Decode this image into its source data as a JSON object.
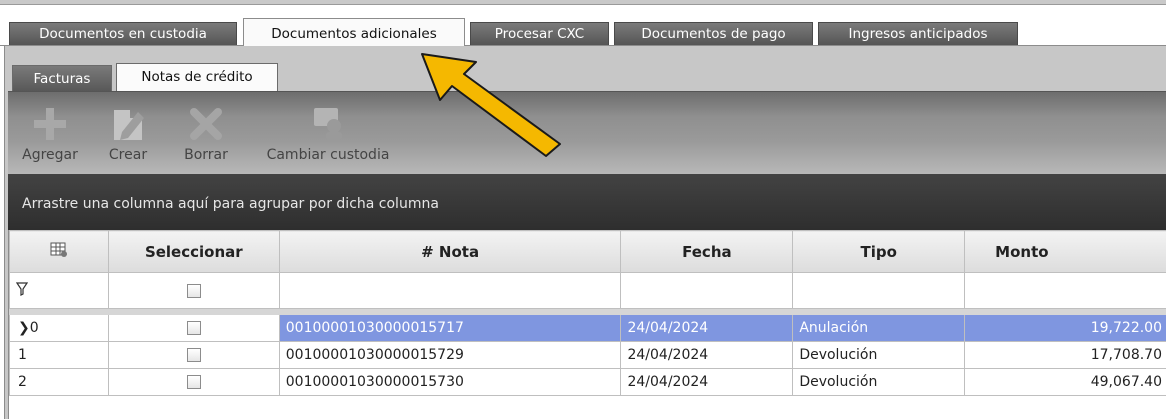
{
  "tabs": [
    {
      "label": "Documentos en custodia",
      "active": false
    },
    {
      "label": "Documentos adicionales",
      "active": true
    },
    {
      "label": "Procesar CXC",
      "active": false
    },
    {
      "label": "Documentos de pago",
      "active": false
    },
    {
      "label": "Ingresos anticipados",
      "active": false
    }
  ],
  "subtabs": [
    {
      "label": "Facturas",
      "active": false
    },
    {
      "label": "Notas de crédito",
      "active": true
    }
  ],
  "toolbar": {
    "agregar": "Agregar",
    "crear": "Crear",
    "borrar": "Borrar",
    "cambiar_custodia": "Cambiar custodia",
    "icons": [
      "plus-icon",
      "pencil-icon",
      "delete-x-icon",
      "custody-icon"
    ]
  },
  "group_panel": {
    "text": "Arrastre una columna aquí para agrupar por dicha columna"
  },
  "grid": {
    "columns": [
      "Seleccionar",
      "# Nota",
      "Fecha",
      "Tipo",
      "Monto"
    ],
    "rows": [
      {
        "indicator": "0",
        "nota": "00100001030000015717",
        "fecha": "24/04/2024",
        "tipo": "Anulación",
        "monto": "19,722.00"
      },
      {
        "indicator": "1",
        "nota": "00100001030000015729",
        "fecha": "24/04/2024",
        "tipo": "Devolución",
        "monto": "17,708.70"
      },
      {
        "indicator": "2",
        "nota": "00100001030000015730",
        "fecha": "24/04/2024",
        "tipo": "Devolución",
        "monto": "49,067.40"
      }
    ]
  },
  "colors": {
    "selection": "#7f96e0",
    "annotation_arrow": "#f5b800"
  }
}
